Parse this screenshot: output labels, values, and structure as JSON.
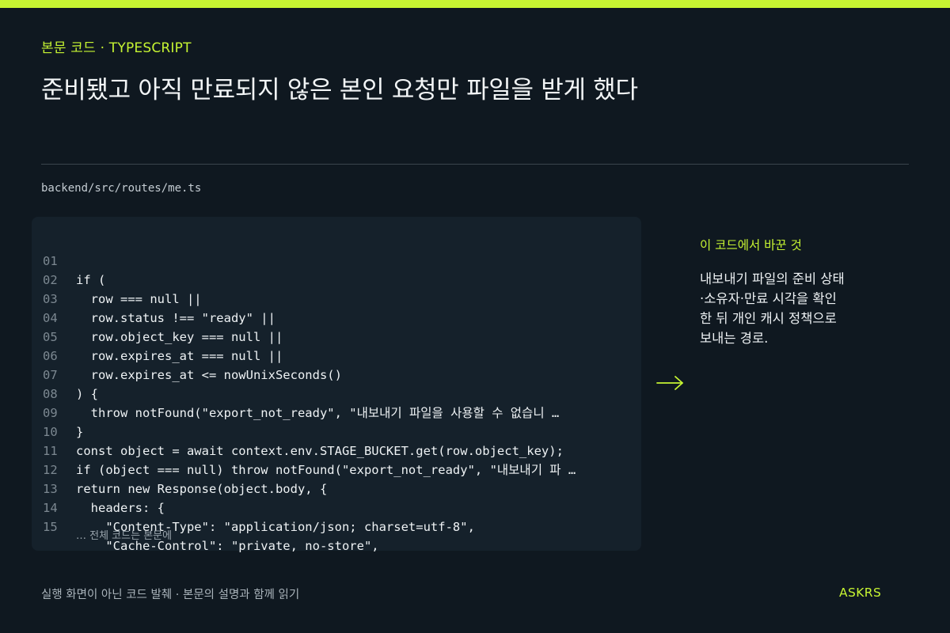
{
  "header": {
    "eyebrow": "본문 코드 · TYPESCRIPT",
    "title": "준비됐고 아직 만료되지 않은 본인 요청만 파일을 받게 했다"
  },
  "file": {
    "path": "backend/src/routes/me.ts"
  },
  "code": {
    "lines": [
      {
        "num": "01",
        "text": "if ("
      },
      {
        "num": "02",
        "text": "  row === null ||"
      },
      {
        "num": "03",
        "text": "  row.status !== \"ready\" ||"
      },
      {
        "num": "04",
        "text": "  row.object_key === null ||"
      },
      {
        "num": "05",
        "text": "  row.expires_at === null ||"
      },
      {
        "num": "06",
        "text": "  row.expires_at <= nowUnixSeconds()"
      },
      {
        "num": "07",
        "text": ") {"
      },
      {
        "num": "08",
        "text": "  throw notFound(\"export_not_ready\", \"내보내기 파일을 사용할 수 없습니 …"
      },
      {
        "num": "09",
        "text": "}"
      },
      {
        "num": "10",
        "text": "const object = await context.env.STAGE_BUCKET.get(row.object_key);"
      },
      {
        "num": "11",
        "text": "if (object === null) throw notFound(\"export_not_ready\", \"내보내기 파 …"
      },
      {
        "num": "12",
        "text": "return new Response(object.body, {"
      },
      {
        "num": "13",
        "text": "  headers: {"
      },
      {
        "num": "14",
        "text": "    \"Content-Type\": \"application/json; charset=utf-8\","
      },
      {
        "num": "15",
        "text": "    \"Cache-Control\": \"private, no-store\","
      }
    ],
    "more": "… 전체 코드는 본문에"
  },
  "side": {
    "heading": "이 코드에서 바꾼 것",
    "body_lines": [
      "내보내기 파일의 준비 상태",
      "·소유자·만료 시각을 확인",
      "한 뒤 개인 캐시 정책으로",
      "보내는 경로."
    ]
  },
  "footer": {
    "note": "실행 화면이 아닌 코드 발췌 · 본문의 설명과 함께 읽기",
    "brand": "ASKRS"
  },
  "icons": {
    "arrow": "arrow-right-icon"
  },
  "colors": {
    "accent": "#c6f432",
    "background": "#0f1820",
    "panel": "#15212b"
  }
}
